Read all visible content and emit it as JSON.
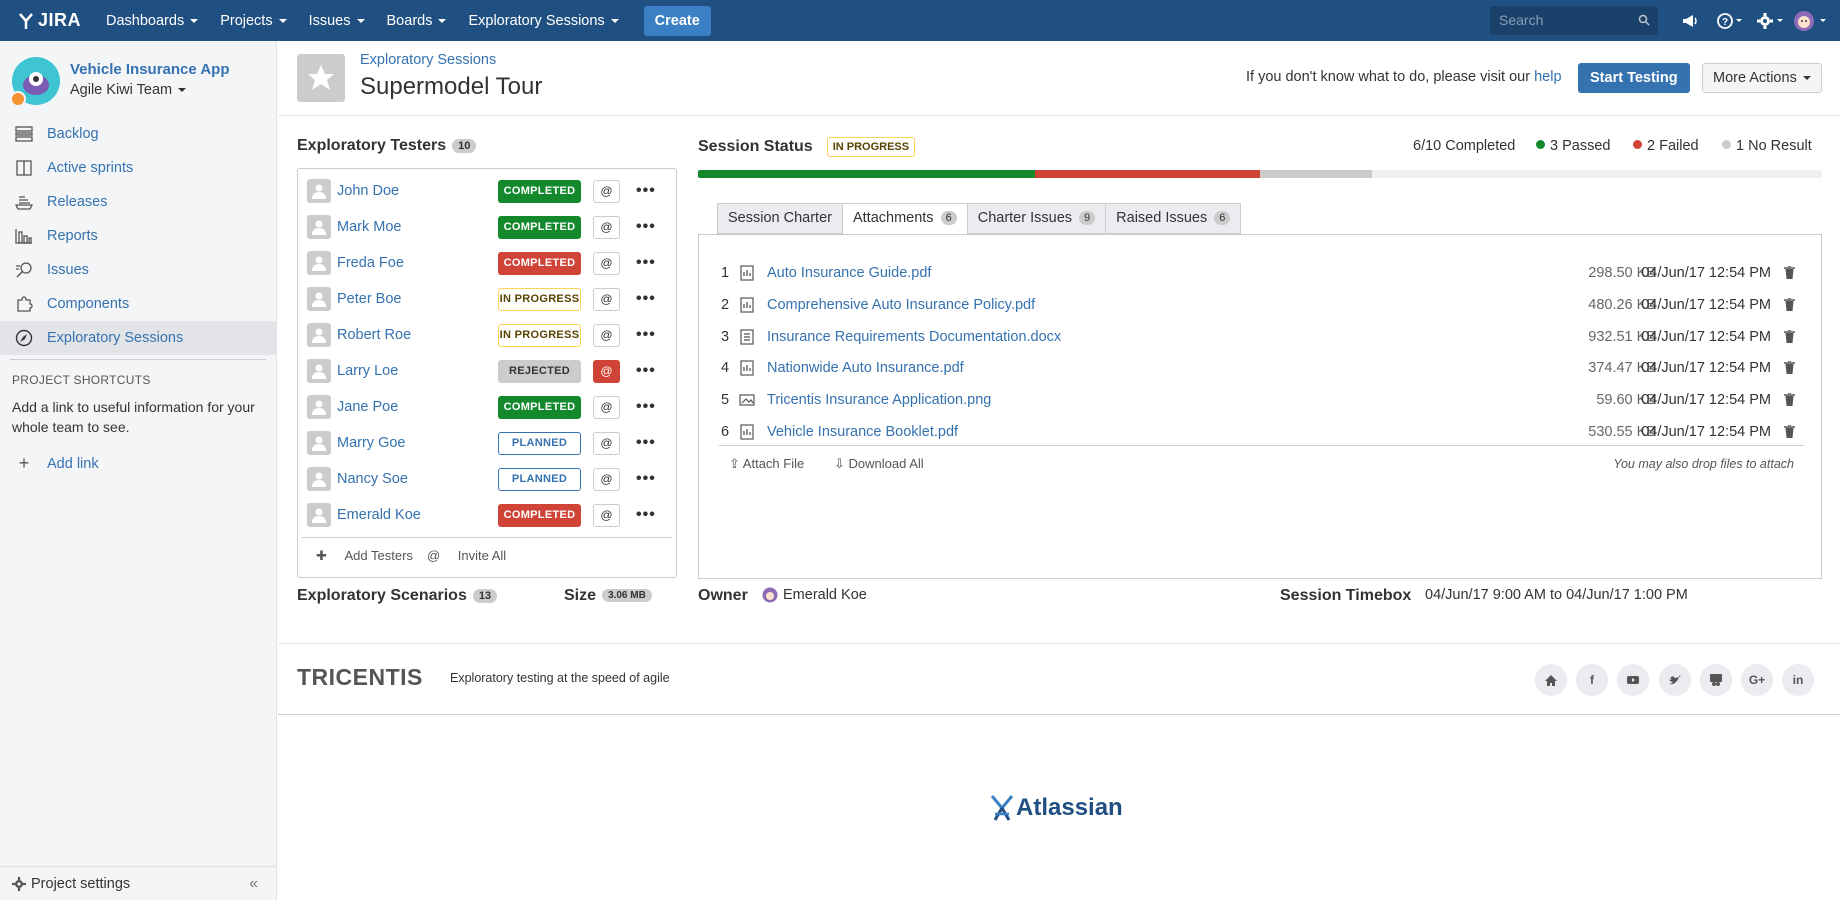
{
  "topnav": {
    "logo_text": "JIRA",
    "items": [
      "Dashboards",
      "Projects",
      "Issues",
      "Boards",
      "Exploratory Sessions"
    ],
    "create_label": "Create",
    "search_placeholder": "Search"
  },
  "sidebar": {
    "project_name": "Vehicle Insurance App",
    "team_name": "Agile Kiwi Team",
    "items": [
      {
        "label": "Backlog",
        "icon": "backlog-icon"
      },
      {
        "label": "Active sprints",
        "icon": "board-icon"
      },
      {
        "label": "Releases",
        "icon": "ship-icon"
      },
      {
        "label": "Reports",
        "icon": "chart-icon"
      },
      {
        "label": "Issues",
        "icon": "issues-icon"
      },
      {
        "label": "Components",
        "icon": "puzzle-icon"
      },
      {
        "label": "Exploratory Sessions",
        "icon": "compass-icon"
      }
    ],
    "shortcuts_title": "PROJECT SHORTCUTS",
    "shortcuts_desc": "Add a link to useful information for your whole team to see.",
    "add_link": "Add link",
    "settings": "Project settings"
  },
  "header": {
    "breadcrumb": "Exploratory Sessions",
    "title": "Supermodel Tour",
    "help_prefix": "If you don't know what to do, please visit our",
    "help_link": "help",
    "start_testing": "Start Testing",
    "more_actions": "More Actions"
  },
  "testers": {
    "title": "Exploratory Testers",
    "count": "10",
    "rows": [
      {
        "name": "John Doe",
        "status": "COMPLETED",
        "kind": "completed"
      },
      {
        "name": "Mark Moe",
        "status": "COMPLETED",
        "kind": "completed"
      },
      {
        "name": "Freda Foe",
        "status": "COMPLETED",
        "kind": "failed"
      },
      {
        "name": "Peter Boe",
        "status": "IN PROGRESS",
        "kind": "progress"
      },
      {
        "name": "Robert Roe",
        "status": "IN PROGRESS",
        "kind": "progress"
      },
      {
        "name": "Larry Loe",
        "status": "REJECTED",
        "kind": "rejected"
      },
      {
        "name": "Jane Poe",
        "status": "COMPLETED",
        "kind": "completed"
      },
      {
        "name": "Marry Goe",
        "status": "PLANNED",
        "kind": "planned"
      },
      {
        "name": "Nancy Soe",
        "status": "PLANNED",
        "kind": "planned"
      },
      {
        "name": "Emerald Koe",
        "status": "COMPLETED",
        "kind": "failed"
      }
    ],
    "at_label": "@",
    "add_testers": "Add Testers",
    "invite_all": "Invite All"
  },
  "session": {
    "title": "Session Status",
    "status": "IN PROGRESS",
    "completed": "6/10 Completed",
    "passed": "3 Passed",
    "failed": "2 Failed",
    "no_result": "1 No Result",
    "progress": {
      "passed": 0.3,
      "failed": 0.2,
      "no_result": 0.1
    }
  },
  "tabs": [
    {
      "label": "Session Charter",
      "count": ""
    },
    {
      "label": "Attachments",
      "count": "6"
    },
    {
      "label": "Charter Issues",
      "count": "9"
    },
    {
      "label": "Raised Issues",
      "count": "6"
    }
  ],
  "attachments": {
    "rows": [
      {
        "num": "1",
        "name": "Auto Insurance Guide.pdf",
        "size": "298.50 KB",
        "date": "04/Jun/17 12:54 PM",
        "icon": "pdf-icon"
      },
      {
        "num": "2",
        "name": "Comprehensive Auto Insurance Policy.pdf",
        "size": "480.26 KB",
        "date": "04/Jun/17 12:54 PM",
        "icon": "pdf-icon"
      },
      {
        "num": "3",
        "name": "Insurance Requirements Documentation.docx",
        "size": "932.51 KB",
        "date": "04/Jun/17 12:54 PM",
        "icon": "doc-icon"
      },
      {
        "num": "4",
        "name": "Nationwide Auto Insurance.pdf",
        "size": "374.47 KB",
        "date": "04/Jun/17 12:54 PM",
        "icon": "pdf-icon"
      },
      {
        "num": "5",
        "name": "Tricentis Insurance Application.png",
        "size": "59.60 KB",
        "date": "04/Jun/17 12:54 PM",
        "icon": "image-icon"
      },
      {
        "num": "6",
        "name": "Vehicle Insurance Booklet.pdf",
        "size": "530.55 KB",
        "date": "04/Jun/17 12:54 PM",
        "icon": "pdf-icon"
      }
    ],
    "attach_file": "Attach File",
    "download_all": "Download All",
    "drop_hint": "You may also drop files to attach"
  },
  "bottom": {
    "scenarios_label": "Exploratory Scenarios",
    "scenarios_count": "13",
    "size_label": "Size",
    "size_value": "3.06 MB",
    "owner_label": "Owner",
    "owner_name": "Emerald Koe",
    "timebox_label": "Session Timebox",
    "timebox_value": "04/Jun/17 9:00 AM to 04/Jun/17 1:00 PM"
  },
  "footer": {
    "brand": "TRICENTIS",
    "tagline": "Exploratory testing at the speed of agile",
    "social": [
      "home-icon",
      "facebook-icon",
      "youtube-icon",
      "twitter-icon",
      "slideshare-icon",
      "googleplus-icon",
      "linkedin-icon"
    ],
    "atlassian": "Atlassian"
  }
}
